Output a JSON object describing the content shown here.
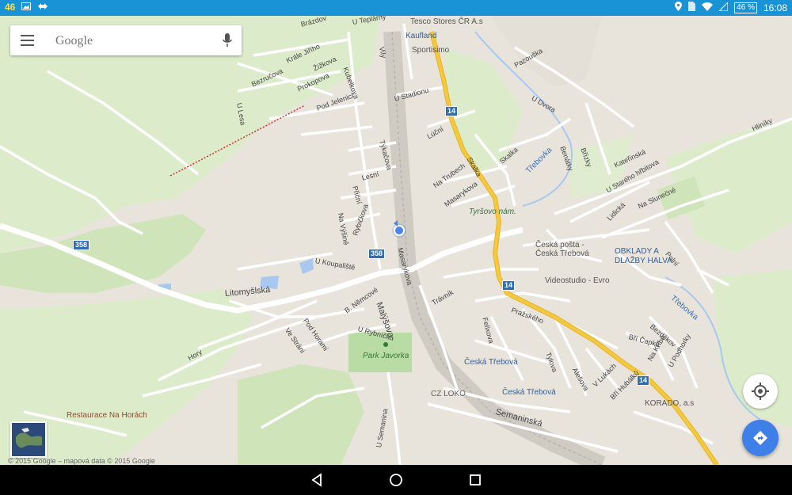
{
  "status_bar": {
    "notification_count": "46",
    "battery": "46 %",
    "time": "16:08"
  },
  "search": {
    "placeholder": "Google"
  },
  "map": {
    "streets": [
      "Brázdov",
      "U Teplárny",
      "Kubelkova",
      "Vily",
      "Krále Jiřího",
      "Žižkova",
      "Bezručova",
      "Prokopova",
      "U Lesa",
      "Pod Jelenicí",
      "U Stadionu",
      "Týkačova",
      "Lúční",
      "Skalka",
      "Skalka",
      "Pazouška",
      "U Dvora",
      "Benátky",
      "Břízky",
      "Hliníky",
      "Kateřinská",
      "U Starého hřbitova",
      "Lidická",
      "Na Slunečné",
      "Polní",
      "Přiční",
      "Lesní",
      "Na Výšině",
      "Rybičkova",
      "Masarykova",
      "Na Trubech",
      "Masarykova",
      "U Koupaliště",
      "Litomyšlská",
      "Pod Horami",
      "B. Němcové",
      "Malýšova",
      "Ve Stráni",
      "U Rybníčka",
      "Trávník",
      "Felixova",
      "Pražského",
      "Tylova",
      "Alešova",
      "V Lukách",
      "Bří Hubálků",
      "Bří Čapků",
      "Bezděkov",
      "Na Kříbě",
      "U Podhorky",
      "Hory",
      "Semaninská",
      "U Semanina"
    ],
    "places": {
      "tesco": "Tesco Stores ČR A.s",
      "kaufland": "Kaufland",
      "sportisimo": "Sportisimo",
      "tyrsovo": "Tyršovo nám.",
      "posta": "Česká pošta - Česká Třebová",
      "obklady": "OBKLADY A DLAŽBY HALVA",
      "videostudio": "Videostudio - Evro",
      "park": "Park Javorka",
      "station1": "Česká Třebová",
      "station2": "Česká Třebová",
      "czloko": "CZ LOKO",
      "korado": "KORADO, a.s",
      "restaurace": "Restaurace Na Horách"
    },
    "rivers": [
      "Třebovka",
      "Třebovka"
    ],
    "road_shields": [
      "14",
      "14",
      "14",
      "358",
      "358"
    ]
  },
  "copyright": "© 2015 Google – mapová data © 2015 Google",
  "icons": {
    "menu": "hamburger-menu-icon",
    "mic": "microphone-icon",
    "my_location": "my-location-icon",
    "directions": "directions-icon"
  },
  "colors": {
    "status_bar": "#1a92d6",
    "highway": "#f4c842",
    "water": "#a8c8f0",
    "park": "#cfe4b8",
    "directions_button": "#3f7fe8"
  }
}
